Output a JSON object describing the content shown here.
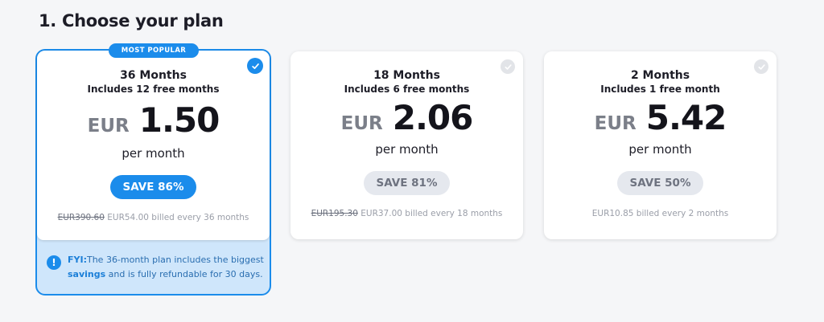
{
  "page": {
    "heading": "1. Choose your plan"
  },
  "plans": [
    {
      "badge": "MOST POPULAR",
      "term": "36 Months",
      "includes": "Includes 12 free months",
      "currency": "EUR",
      "amount": "1.50",
      "per": "per month",
      "save": "SAVE 86%",
      "old_price": "EUR390.60",
      "billed": "EUR54.00 billed every 36 months",
      "selected": true,
      "fyi_label": "FYI:",
      "fyi_text_1": "The 36-month plan includes the biggest",
      "fyi_bold": "savings",
      "fyi_text_2": " and is fully refundable for 30 days."
    },
    {
      "term": "18 Months",
      "includes": "Includes 6 free months",
      "currency": "EUR",
      "amount": "2.06",
      "per": "per month",
      "save": "SAVE 81%",
      "old_price": "EUR195.30",
      "billed": "EUR37.00 billed every 18 months",
      "selected": false
    },
    {
      "term": "2 Months",
      "includes": "Includes 1 free month",
      "currency": "EUR",
      "amount": "5.42",
      "per": "per month",
      "save": "SAVE 50%",
      "billed": "EUR10.85 billed every 2 months",
      "selected": false
    }
  ],
  "colors": {
    "accent": "#1b8ceb",
    "background": "#f5f6f8",
    "fyi_background": "#cfe6fb",
    "save_inactive": "#e5e8ee"
  },
  "icons": {
    "check": "check-circle-icon",
    "info": "info-circle-icon"
  }
}
